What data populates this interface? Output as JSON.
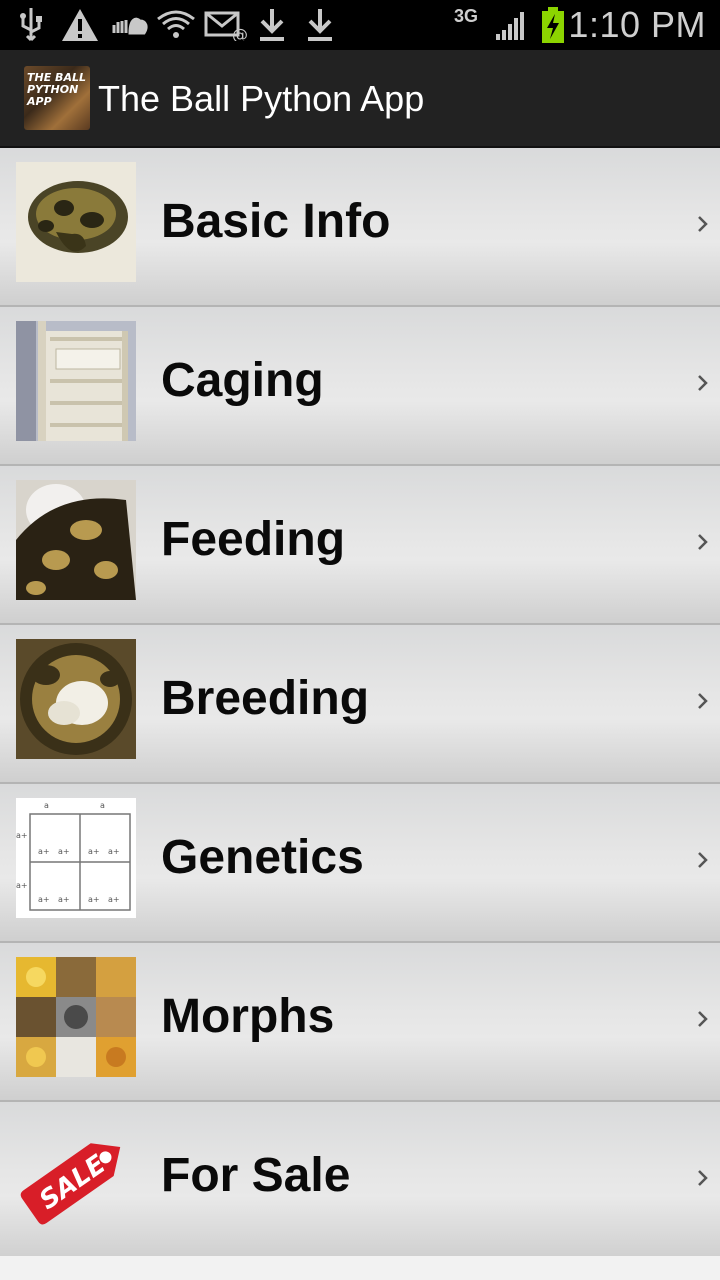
{
  "status_bar": {
    "time": "1:10 PM",
    "network": "3G",
    "icons": [
      "usb-icon",
      "warning-icon",
      "soundcloud-icon",
      "wifi-icon",
      "email-icon",
      "download-icon",
      "download-icon",
      "signal-icon",
      "battery-charging-icon"
    ]
  },
  "action_bar": {
    "logo_text": "THE BALL PYTHON APP",
    "title": "The Ball Python App"
  },
  "menu": {
    "items": [
      {
        "label": "Basic Info",
        "icon": "basic-info-thumbnail"
      },
      {
        "label": "Caging",
        "icon": "caging-thumbnail"
      },
      {
        "label": "Feeding",
        "icon": "feeding-thumbnail"
      },
      {
        "label": "Breeding",
        "icon": "breeding-thumbnail"
      },
      {
        "label": "Genetics",
        "icon": "genetics-punnett-thumbnail"
      },
      {
        "label": "Morphs",
        "icon": "morphs-thumbnail"
      },
      {
        "label": "For Sale",
        "icon": "sale-tag-thumbnail"
      }
    ]
  },
  "colors": {
    "status_bar_bg": "#000000",
    "action_bar_bg": "#222222",
    "item_bg": "#e6e6e6",
    "battery": "#8cd400"
  }
}
